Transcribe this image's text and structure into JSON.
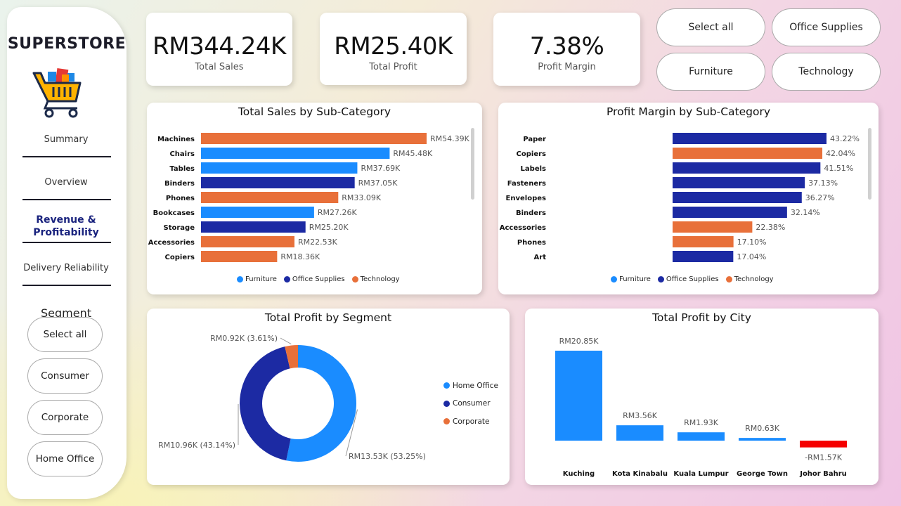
{
  "brand": "SUPERSTORE",
  "nav": {
    "summary": "Summary",
    "overview": "Overview",
    "revenue": "Revenue & Profitability",
    "delivery": "Delivery Reliability"
  },
  "segment_filter": {
    "title": "Segment",
    "options": [
      "Select all",
      "Consumer",
      "Corporate",
      "Home Office"
    ]
  },
  "kpis": {
    "total_sales": {
      "value": "RM344.24K",
      "label": "Total Sales"
    },
    "total_profit": {
      "value": "RM25.40K",
      "label": "Total Profit"
    },
    "profit_margin": {
      "value": "7.38%",
      "label": "Profit Margin"
    }
  },
  "category_filter": {
    "options": [
      "Select all",
      "Office Supplies",
      "Furniture",
      "Technology"
    ]
  },
  "colors": {
    "Furniture": "#1a8cff",
    "Office Supplies": "#1c2aa3",
    "Technology": "#e8703a",
    "Negative": "#f50000"
  },
  "chart_data": [
    {
      "id": "sales_by_subcat",
      "type": "bar",
      "orientation": "horizontal",
      "title": "Total Sales by Sub-Category",
      "categories": [
        "Machines",
        "Chairs",
        "Tables",
        "Binders",
        "Phones",
        "Bookcases",
        "Storage",
        "Accessories",
        "Copiers"
      ],
      "values": [
        54.39,
        45.48,
        37.69,
        37.05,
        33.09,
        27.26,
        25.2,
        22.53,
        18.36
      ],
      "value_labels": [
        "RM54.39K",
        "RM45.48K",
        "RM37.69K",
        "RM37.05K",
        "RM33.09K",
        "RM27.26K",
        "RM25.20K",
        "RM22.53K",
        "RM18.36K"
      ],
      "groups": [
        "Technology",
        "Furniture",
        "Furniture",
        "Office Supplies",
        "Technology",
        "Furniture",
        "Office Supplies",
        "Technology",
        "Technology"
      ],
      "legend": [
        "Furniture",
        "Office Supplies",
        "Technology"
      ],
      "legend_position": "bottom"
    },
    {
      "id": "margin_by_subcat",
      "type": "bar",
      "orientation": "horizontal",
      "title": "Profit Margin by Sub-Category",
      "categories": [
        "Paper",
        "Copiers",
        "Labels",
        "Fasteners",
        "Envelopes",
        "Binders",
        "Accessories",
        "Phones",
        "Art"
      ],
      "values": [
        43.22,
        42.04,
        41.51,
        37.13,
        36.27,
        32.14,
        22.38,
        17.1,
        17.04
      ],
      "value_labels": [
        "43.22%",
        "42.04%",
        "41.51%",
        "37.13%",
        "36.27%",
        "32.14%",
        "22.38%",
        "17.10%",
        "17.04%"
      ],
      "groups": [
        "Office Supplies",
        "Technology",
        "Office Supplies",
        "Office Supplies",
        "Office Supplies",
        "Office Supplies",
        "Technology",
        "Technology",
        "Office Supplies"
      ],
      "legend": [
        "Furniture",
        "Office Supplies",
        "Technology"
      ],
      "legend_position": "bottom"
    },
    {
      "id": "profit_by_segment",
      "type": "pie",
      "donut": true,
      "title": "Total Profit by Segment",
      "categories": [
        "Home Office",
        "Consumer",
        "Corporate"
      ],
      "values": [
        13.53,
        10.96,
        0.92
      ],
      "percents": [
        53.25,
        43.14,
        3.61
      ],
      "value_labels": [
        "RM13.53K (53.25%)",
        "RM10.96K (43.14%)",
        "RM0.92K (3.61%)"
      ],
      "colors": [
        "#1a8cff",
        "#1c2aa3",
        "#e8703a"
      ],
      "legend_position": "right"
    },
    {
      "id": "profit_by_city",
      "type": "bar",
      "orientation": "vertical",
      "title": "Total Profit by City",
      "categories": [
        "Kuching",
        "Kota Kinabalu",
        "Kuala Lumpur",
        "George Town",
        "Johor Bahru"
      ],
      "values": [
        20.85,
        3.56,
        1.93,
        0.63,
        -1.57
      ],
      "value_labels": [
        "RM20.85K",
        "RM3.56K",
        "RM1.93K",
        "RM0.63K",
        "-RM1.57K"
      ]
    }
  ]
}
